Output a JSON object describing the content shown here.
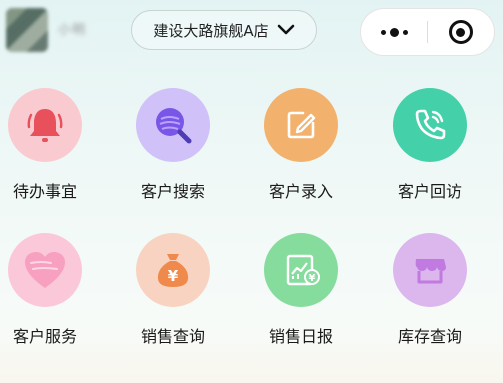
{
  "header": {
    "username": "小明",
    "store_select": {
      "label": "建设大路旗舰A店"
    },
    "capsule": {
      "more_icon": "more-dots-icon",
      "close_icon": "target-close-icon"
    }
  },
  "colors": {
    "todo": "#f9c6cc",
    "search": "#c9b8f5",
    "entry": "#f2b26d",
    "visit": "#4fd3b0",
    "service": "#f9c4d6",
    "sales_query": "#f5cbb5",
    "sales_daily": "#86dc9d",
    "stock": "#d8b4ec"
  },
  "menu": {
    "items": [
      {
        "label": "待办事宜",
        "icon": "bell-icon"
      },
      {
        "label": "客户搜索",
        "icon": "search-icon"
      },
      {
        "label": "客户录入",
        "icon": "edit-icon"
      },
      {
        "label": "客户回访",
        "icon": "phone-icon"
      },
      {
        "label": "客户服务",
        "icon": "heart-icon"
      },
      {
        "label": "销售查询",
        "icon": "money-bag-icon"
      },
      {
        "label": "销售日报",
        "icon": "report-icon"
      },
      {
        "label": "库存查询",
        "icon": "store-icon"
      }
    ]
  }
}
